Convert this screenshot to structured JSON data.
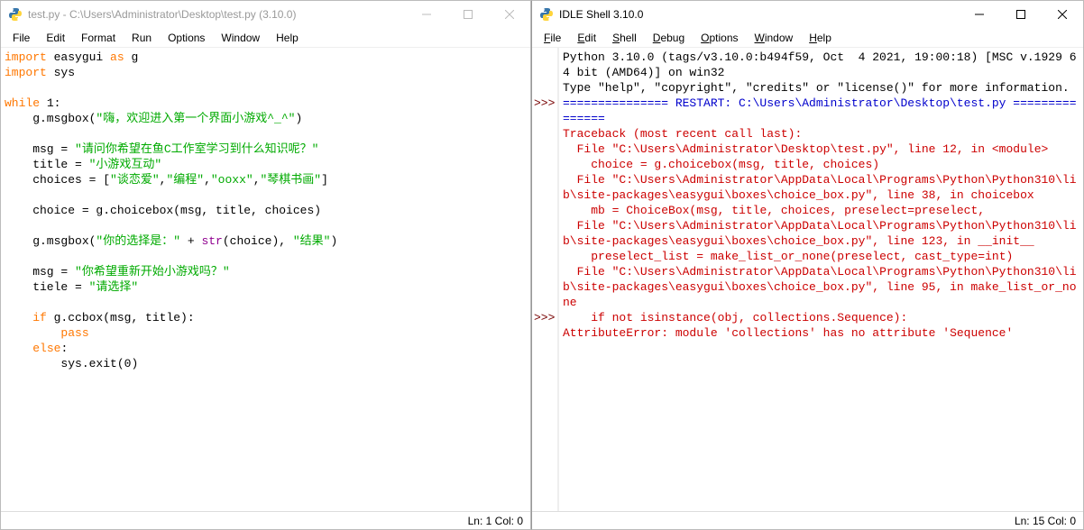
{
  "left": {
    "title": "test.py - C:\\Users\\Administrator\\Desktop\\test.py (3.10.0)",
    "menus": [
      "File",
      "Edit",
      "Format",
      "Run",
      "Options",
      "Window",
      "Help"
    ],
    "status": "Ln: 1  Col: 0"
  },
  "right": {
    "title": "IDLE Shell 3.10.0",
    "menus": [
      "File",
      "Edit",
      "Shell",
      "Debug",
      "Options",
      "Window",
      "Help"
    ],
    "status": "Ln: 15  Col: 0",
    "banner1": "Python 3.10.0 (tags/v3.10.0:b494f59, Oct  4 2021, 19:00:18) [MSC v.1929 64 bit (AMD64)] on win32",
    "banner2": "Type \"help\", \"copyright\", \"credits\" or \"license()\" for more information.",
    "restart": "=============== RESTART: C:\\Users\\Administrator\\Desktop\\test.py ===============",
    "tb0": "Traceback (most recent call last):",
    "tb1": "  File \"C:\\Users\\Administrator\\Desktop\\test.py\", line 12, in <module>",
    "tb2": "    choice = g.choicebox(msg, title, choices)",
    "tb3": "  File \"C:\\Users\\Administrator\\AppData\\Local\\Programs\\Python\\Python310\\lib\\site-packages\\easygui\\boxes\\choice_box.py\", line 38, in choicebox",
    "tb4": "    mb = ChoiceBox(msg, title, choices, preselect=preselect,",
    "tb5": "  File \"C:\\Users\\Administrator\\AppData\\Local\\Programs\\Python\\Python310\\lib\\site-packages\\easygui\\boxes\\choice_box.py\", line 123, in __init__",
    "tb6": "    preselect_list = make_list_or_none(preselect, cast_type=int)",
    "tb7": "  File \"C:\\Users\\Administrator\\AppData\\Local\\Programs\\Python\\Python310\\lib\\site-packages\\easygui\\boxes\\choice_box.py\", line 95, in make_list_or_none",
    "tb8": "    if not isinstance(obj, collections.Sequence):",
    "tb9": "AttributeError: module 'collections' has no attribute 'Sequence'"
  },
  "code": {
    "l1a": "import",
    "l1b": " easygui ",
    "l1c": "as",
    "l1d": " g",
    "l2a": "import",
    "l2b": " sys",
    "l4a": "while",
    "l4b": " ",
    "l4c": "1",
    "l4d": ":",
    "l5a": "    g.msgbox(",
    "l5b": "\"嗨，欢迎进入第一个界面小游戏^_^\"",
    "l5c": ")",
    "l7a": "    msg = ",
    "l7b": "\"请问你希望在鱼C工作室学习到什么知识呢？\"",
    "l8a": "    title = ",
    "l8b": "\"小游戏互动\"",
    "l9a": "    choices = [",
    "l9b": "\"谈恋爱\"",
    "l9c": ",",
    "l9d": "\"编程\"",
    "l9e": ",",
    "l9f": "\"ooxx\"",
    "l9g": ",",
    "l9h": "\"琴棋书画\"",
    "l9i": "]",
    "l11": "    choice = g.choicebox(msg, title, choices)",
    "l13a": "    g.msgbox(",
    "l13b": "\"你的选择是：\"",
    "l13c": " + ",
    "l13d": "str",
    "l13e": "(choice), ",
    "l13f": "\"结果\"",
    "l13g": ")",
    "l15a": "    msg = ",
    "l15b": "\"你希望重新开始小游戏吗？\"",
    "l16a": "    tiele = ",
    "l16b": "\"请选择\"",
    "l18a": "    ",
    "l18b": "if",
    "l18c": " g.ccbox(msg, title):",
    "l19a": "        ",
    "l19b": "pass",
    "l20a": "    ",
    "l20b": "else",
    "l20c": ":",
    "l21a": "        sys.exit(",
    "l21b": "0",
    "l21c": ")"
  },
  "prompts": {
    "p1": ">>>",
    "p2": ">>>"
  }
}
